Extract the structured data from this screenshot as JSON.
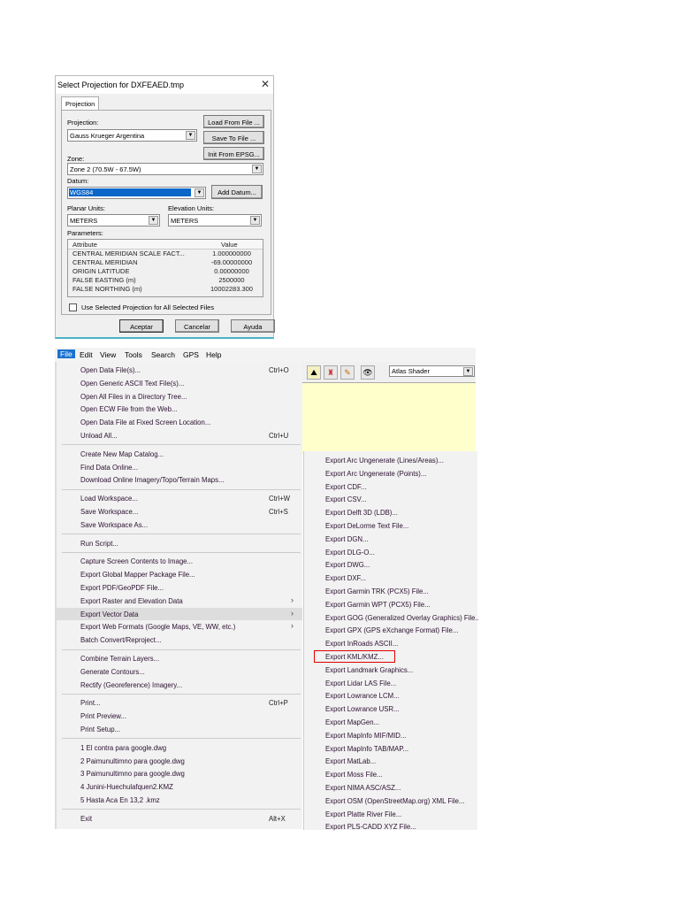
{
  "dialog": {
    "title": "Select Projection for DXFEAED.tmp",
    "tab": "Projection",
    "projection_label": "Projection:",
    "projection_value": "Gauss Krueger Argentina",
    "load_from_file": "Load From File ...",
    "save_to_file": "Save To File ...",
    "init_from_epsg": "Init From EPSG...",
    "zone_label": "Zone:",
    "zone_value": "Zone 2 (70.5W - 67.5W)",
    "datum_label": "Datum:",
    "datum_value": "WGS84",
    "add_datum": "Add Datum...",
    "planar_units_label": "Planar Units:",
    "planar_units_value": "METERS",
    "elevation_units_label": "Elevation Units:",
    "elevation_units_value": "METERS",
    "parameters_label": "Parameters:",
    "columns": [
      "Attribute",
      "Value"
    ],
    "parameters": [
      {
        "attribute": "CENTRAL MERIDIAN SCALE FACT...",
        "value": "1.000000000"
      },
      {
        "attribute": "CENTRAL MERIDIAN",
        "value": "-69.00000000"
      },
      {
        "attribute": "ORIGIN LATITUDE",
        "value": "0.00000000"
      },
      {
        "attribute": "FALSE EASTING (m)",
        "value": "2500000"
      },
      {
        "attribute": "FALSE NORTHING (m)",
        "value": "10002283.300"
      }
    ],
    "checkbox_label": "Use Selected Projection for All Selected Files",
    "checkbox_checked": false,
    "ok": "Aceptar",
    "cancel": "Cancelar",
    "help": "Ayuda"
  },
  "menubar": [
    "File",
    "Edit",
    "View",
    "Tools",
    "Search",
    "GPS",
    "Help"
  ],
  "file_menu": [
    [
      {
        "label": "Open Data File(s)...",
        "shortcut": "Ctrl+O"
      },
      {
        "label": "Open Generic ASCII Text File(s)..."
      },
      {
        "label": "Open All Files in a Directory Tree..."
      },
      {
        "label": "Open ECW File from the Web..."
      },
      {
        "label": "Open Data File at Fixed Screen Location..."
      },
      {
        "label": "Unload All...",
        "shortcut": "Ctrl+U"
      }
    ],
    [
      {
        "label": "Create New Map Catalog..."
      },
      {
        "label": "Find Data Online..."
      },
      {
        "label": "Download Online Imagery/Topo/Terrain Maps..."
      }
    ],
    [
      {
        "label": "Load Workspace...",
        "shortcut": "Ctrl+W"
      },
      {
        "label": "Save Workspace...",
        "shortcut": "Ctrl+S"
      },
      {
        "label": "Save Workspace As..."
      }
    ],
    [
      {
        "label": "Run Script..."
      }
    ],
    [
      {
        "label": "Capture Screen Contents to Image..."
      },
      {
        "label": "Export Global Mapper Package File..."
      },
      {
        "label": "Export PDF/GeoPDF File..."
      },
      {
        "label": "Export Raster and Elevation Data",
        "submenu": true
      },
      {
        "label": "Export Vector Data",
        "submenu": true,
        "highlighted": true
      },
      {
        "label": "Export Web Formats (Google Maps, VE, WW, etc.)",
        "submenu": true
      },
      {
        "label": "Batch Convert/Reproject..."
      }
    ],
    [
      {
        "label": "Combine Terrain Layers..."
      },
      {
        "label": "Generate Contours..."
      },
      {
        "label": "Rectify (Georeference) Imagery..."
      }
    ],
    [
      {
        "label": "Print...",
        "shortcut": "Ctrl+P"
      },
      {
        "label": "Print Preview..."
      },
      {
        "label": "Print Setup..."
      }
    ],
    [
      {
        "label": "1 El contra para google.dwg"
      },
      {
        "label": "2 Paimunultimno para google.dwg"
      },
      {
        "label": "3 Paimunultimno para google.dwg"
      },
      {
        "label": "4 Junini-Huechulafquen2.KMZ"
      },
      {
        "label": "5 Hasta Aca En 13,2 .kmz"
      }
    ],
    [
      {
        "label": "Exit",
        "shortcut": "Alt+X"
      }
    ]
  ],
  "toolbar": {
    "shader": "Atlas Shader",
    "icons": [
      "shader-icon",
      "tower-icon",
      "pencil-icon",
      "binoculars-icon"
    ]
  },
  "export_vector_submenu": [
    "Export Arc Ungenerate (Lines/Areas)...",
    "Export Arc Ungenerate (Points)...",
    "Export CDF...",
    "Export CSV...",
    "Export Delft 3D (LDB)...",
    "Export DeLorme Text File...",
    "Export DGN...",
    "Export DLG-O...",
    "Export DWG...",
    "Export DXF...",
    "Export Garmin TRK (PCX5) File...",
    "Export Garmin WPT (PCX5) File...",
    "Export GOG (Generalized Overlay Graphics) File...",
    "Export GPX (GPS eXchange Format) File...",
    "Export InRoads ASCII...",
    "Export KML/KMZ...",
    "Export Landmark Graphics...",
    "Export Lidar LAS File...",
    "Export Lowrance LCM...",
    "Export Lowrance USR...",
    "Export MapGen...",
    "Export MapInfo MIF/MID...",
    "Export MapInfo TAB/MAP...",
    "Export MatLab...",
    "Export Moss File...",
    "Export NIMA ASC/ASZ...",
    "Export OSM (OpenStreetMap.org) XML File...",
    "Export Platte River File...",
    "Export PLS-CADD XYZ File..."
  ],
  "highlight_color": "#e00000"
}
